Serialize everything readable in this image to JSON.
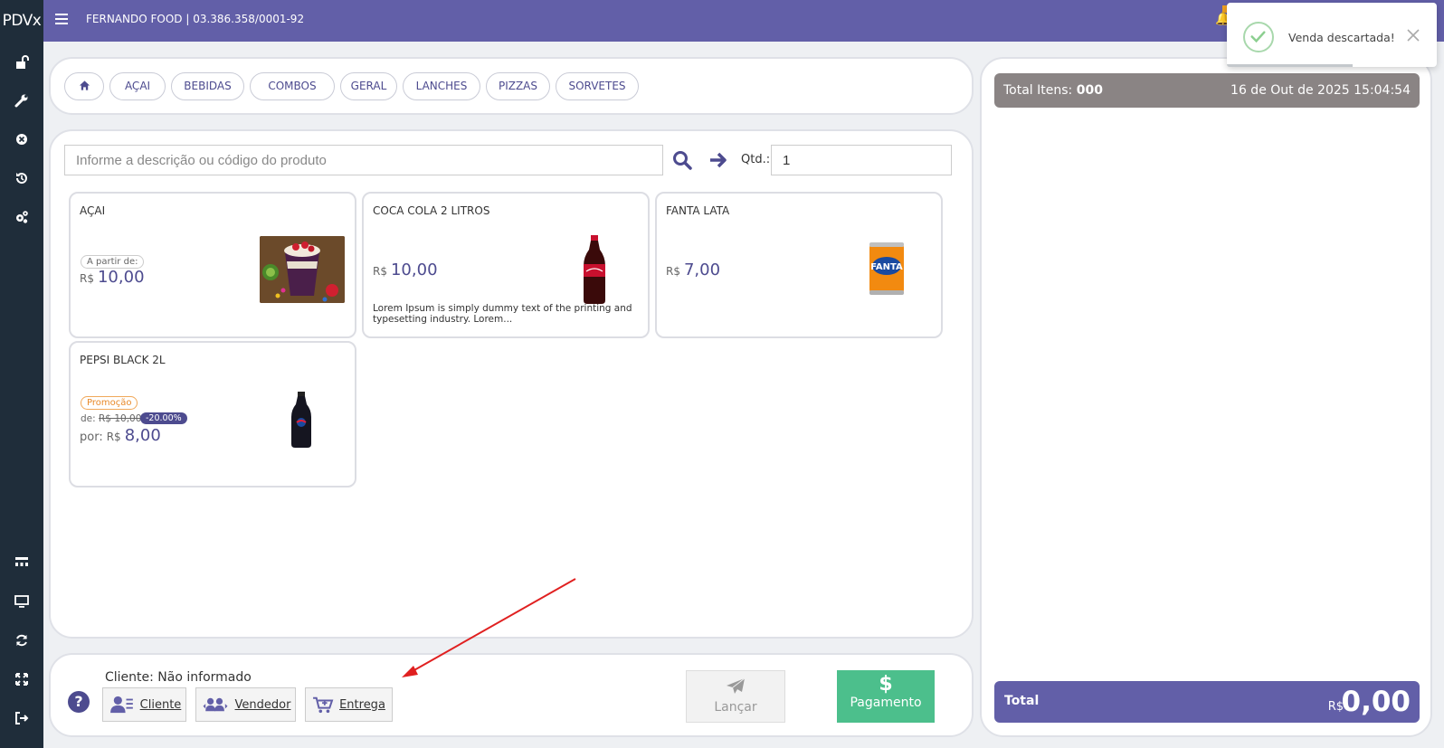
{
  "brand": "PDVx",
  "company": "FERNANDO FOOD | 03.386.358/0001-92",
  "colors": {
    "primary": "#625fa8",
    "sidebar": "#1f2d3a",
    "accent_text": "#4d4b8f",
    "total_items_bar": "#8a8484",
    "payment_button": "#4cbf8c",
    "promo": "#e8892a",
    "annotation_arrow": "#e02020"
  },
  "sidebar": {
    "icons": [
      "unlock-icon",
      "wrench-icon",
      "cancel-circle-icon",
      "history-icon",
      "cogs-icon",
      "sitemap-icon",
      "monitor-icon",
      "refresh-icon",
      "fullscreen-icon",
      "logout-icon"
    ]
  },
  "categories": {
    "home_icon": "home-icon",
    "items": [
      "AÇAI",
      "BEBIDAS",
      "COMBOS",
      "GERAL",
      "LANCHES",
      "PIZZAS",
      "SORVETES"
    ]
  },
  "search": {
    "placeholder": "Informe a descrição ou código do produto",
    "value": "",
    "qty_label": "Qtd.:",
    "qty_value": "1"
  },
  "products": [
    {
      "name": "AÇAI",
      "from_label": "A partir de:",
      "currency": "R$",
      "price": "10,00"
    },
    {
      "name": "COCA COLA 2 LITROS",
      "currency": "R$",
      "price": "10,00",
      "description": "Lorem Ipsum is simply dummy text of the printing and typesetting industry. Lorem..."
    },
    {
      "name": "FANTA LATA",
      "currency": "R$",
      "price": "7,00",
      "image_logo_text": "FANTA"
    },
    {
      "name": "PEPSI BLACK 2L",
      "promo_label": "Promoção",
      "old_prefix": "de:",
      "old_price": "R$ 10,00",
      "discount": "-20.00%",
      "now_prefix": "por:",
      "currency": "R$",
      "price": "8,00"
    }
  ],
  "bottom": {
    "cliente_info": "Cliente: Não informado",
    "help_icon": "?",
    "buttons": {
      "cliente": "Cliente",
      "vendedor": "Vendedor",
      "entrega": "Entrega",
      "lancar": "Lançar",
      "pagamento": "Pagamento",
      "pagamento_symbol": "$"
    }
  },
  "cart": {
    "total_items_label": "Total Itens:",
    "total_items_value": "000",
    "datetime": "16 de Out de 2025 15:04:54",
    "total_label": "Total",
    "total_currency": "R$",
    "total_value": "0,00"
  },
  "toast": {
    "message": "Venda descartada!",
    "progress": 0.6
  }
}
